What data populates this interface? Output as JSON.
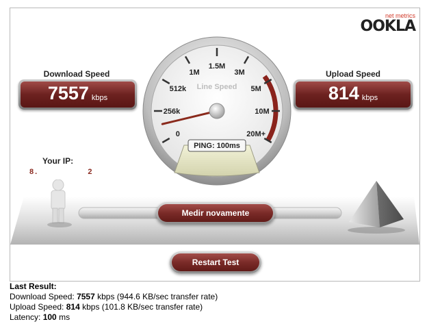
{
  "brand": {
    "tagline": "net metrics",
    "name": "OOKLA"
  },
  "download": {
    "label": "Download Speed",
    "value": "7557",
    "unit": "kbps"
  },
  "upload": {
    "label": "Upload Speed",
    "value": "814",
    "unit": "kbps"
  },
  "gauge": {
    "title": "Line Speed",
    "ticks": [
      "0",
      "256k",
      "512k",
      "1M",
      "1.5M",
      "3M",
      "5M",
      "10M",
      "20M+"
    ],
    "ping_text": "PING: 100ms"
  },
  "ip": {
    "label": "Your IP:",
    "value_left": "8.",
    "value_right": "2"
  },
  "buttons": {
    "retest": "Medir novamente",
    "restart": "Restart Test"
  },
  "last_result": {
    "title": "Last Result:",
    "download_prefix": "Download Speed: ",
    "download_value": "7557",
    "download_suffix": " kbps (944.6 KB/sec transfer rate)",
    "upload_prefix": "Upload Speed: ",
    "upload_value": "814",
    "upload_suffix": " kbps (101.8 KB/sec transfer rate)",
    "latency_prefix": "Latency: ",
    "latency_value": "100",
    "latency_suffix": " ms"
  }
}
